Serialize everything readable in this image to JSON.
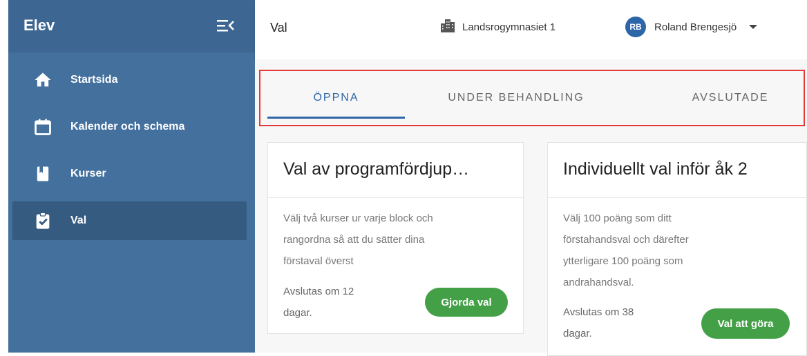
{
  "sidebar": {
    "brand": "Elev",
    "items": [
      {
        "label": "Startsida",
        "icon": "home-icon"
      },
      {
        "label": "Kalender och schema",
        "icon": "calendar-icon"
      },
      {
        "label": "Kurser",
        "icon": "book-icon"
      },
      {
        "label": "Val",
        "icon": "clipboard-check-icon",
        "active": true
      }
    ]
  },
  "header": {
    "title": "Val",
    "school": "Landsrogymnasiet 1",
    "user_initials": "RB",
    "user_name": "Roland Brengesjö"
  },
  "tabs": [
    {
      "label": "ÖPPNA",
      "active": true
    },
    {
      "label": "UNDER BEHANDLING"
    },
    {
      "label": "AVSLUTADE"
    }
  ],
  "cards": [
    {
      "title": "Val av programfördjup…",
      "desc": [
        "Välj två kurser ur varje block och",
        "rangordna så att du sätter dina",
        "förstaval överst"
      ],
      "footer": [
        "Avslutas om 12",
        "dagar."
      ],
      "button": "Gjorda val"
    },
    {
      "title": "Individuellt val inför åk 2",
      "desc": [
        "Välj 100 poäng som ditt",
        "förstahandsval och därefter",
        "ytterligare 100 poäng som",
        "andrahandsval."
      ],
      "footer": [
        "Avslutas om 38",
        "dagar."
      ],
      "button": "Val att göra"
    }
  ],
  "colors": {
    "sidebar": "#43709d",
    "accent": "#2c65a8",
    "button_green": "#43a047",
    "highlight_border": "#e33b3b"
  }
}
